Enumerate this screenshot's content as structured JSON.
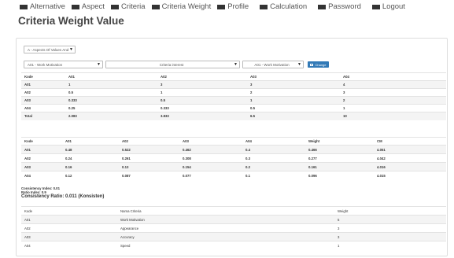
{
  "nav": {
    "items": [
      {
        "label": "Alternative"
      },
      {
        "label": "Aspect"
      },
      {
        "label": "Criteria"
      },
      {
        "label": "Criteria Weight"
      },
      {
        "label": "Profile"
      },
      {
        "label": "Calculation"
      },
      {
        "label": "Password"
      },
      {
        "label": "Logout"
      }
    ]
  },
  "page": {
    "title": "Criteria Weight Value"
  },
  "filters": {
    "aspect": "A - Aspects Of Values And Behavior",
    "left_criteria": "A01 - Work Motivation",
    "interest": "Criteria interest",
    "right_criteria": "A01 - Work Motivation",
    "button_label": "Change"
  },
  "matrix": {
    "headers": [
      "Kode",
      "A01",
      "A02",
      "A03",
      "A04"
    ],
    "rows": [
      [
        "A01",
        "1",
        "3",
        "3",
        "4"
      ],
      [
        "A02",
        "0.5",
        "1",
        "2",
        "3"
      ],
      [
        "A03",
        "0.333",
        "0.5",
        "1",
        "2"
      ],
      [
        "A04",
        "0.25",
        "0.333",
        "0.5",
        "1"
      ]
    ],
    "total": [
      "Total",
      "2.083",
      "3.833",
      "6.5",
      "10"
    ]
  },
  "normalized": {
    "headers": [
      "Kode",
      "A01",
      "A02",
      "A03",
      "A04",
      "Weight",
      "CM"
    ],
    "rows": [
      [
        "A01",
        "0.48",
        "0.522",
        "0.462",
        "0.4",
        "0.466",
        "4.051"
      ],
      [
        "A02",
        "0.24",
        "0.261",
        "0.308",
        "0.3",
        "0.277",
        "4.042"
      ],
      [
        "A03",
        "0.16",
        "0.13",
        "0.154",
        "0.2",
        "0.161",
        "4.016"
      ],
      [
        "A04",
        "0.12",
        "0.087",
        "0.077",
        "0.1",
        "0.096",
        "4.015"
      ]
    ]
  },
  "consistency": {
    "index": "Consistency Index: 0.01",
    "ratio_index": "Ratio Index: 0.9",
    "ratio": "Consistency Ratio: 0.011 (Konsisten)"
  },
  "criteria_table": {
    "headers": [
      "Kode",
      "Nama Criteria",
      "Weight"
    ],
    "rows": [
      [
        "A01",
        "Work Motivation",
        "5"
      ],
      [
        "A02",
        "Appearance",
        "3"
      ],
      [
        "A03",
        "Accuracy",
        "3"
      ],
      [
        "A04",
        "Speed",
        "1"
      ]
    ]
  }
}
